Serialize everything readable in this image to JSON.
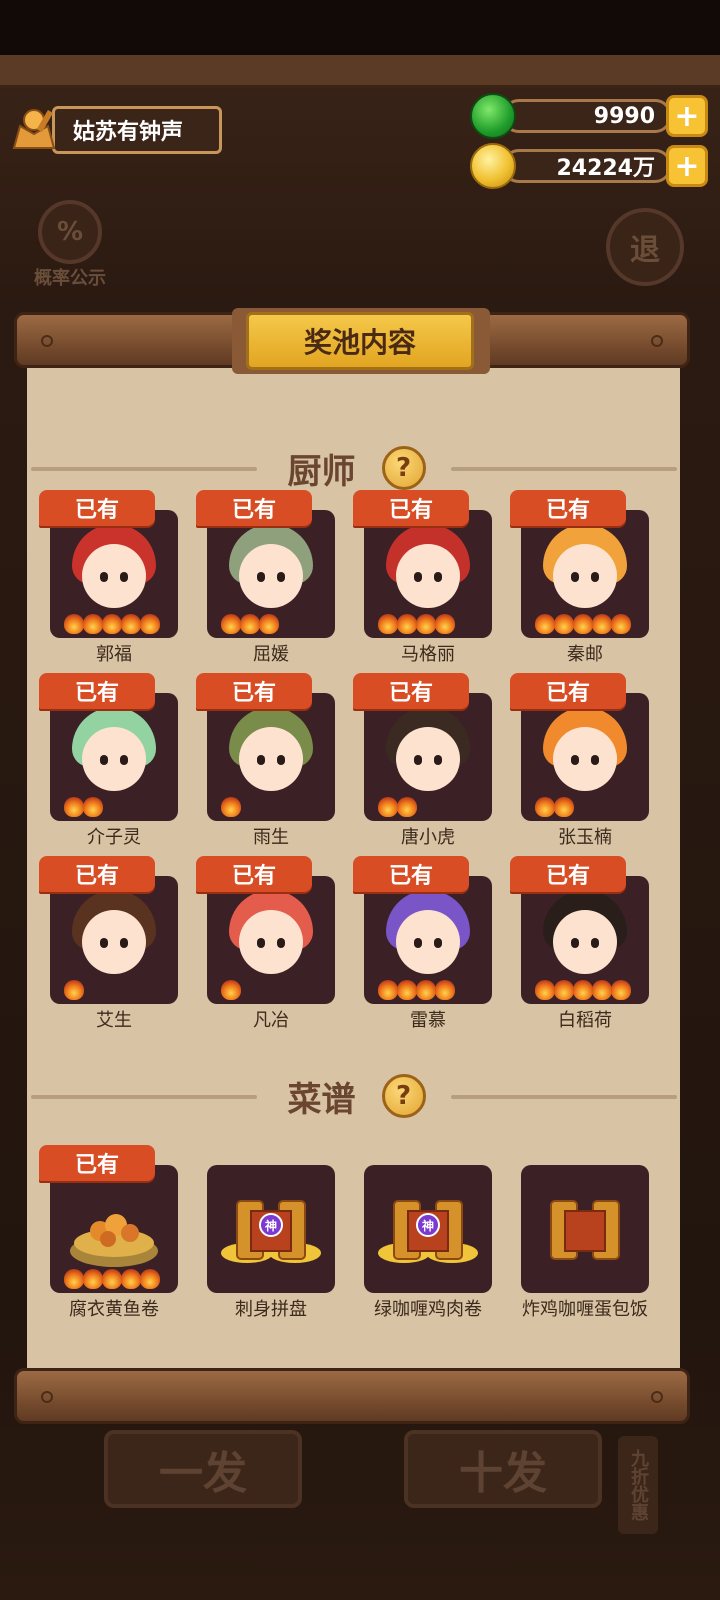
{
  "player": {
    "name": "姑苏有钟声"
  },
  "currency": {
    "jade": "9990",
    "coins": "24224万",
    "plus": "+"
  },
  "side": {
    "probability_icon": "%",
    "probability_label": "概率公示",
    "exit_label": "退"
  },
  "panel": {
    "title": "奖池内容"
  },
  "sections": {
    "chefs": "厨师",
    "recipes": "菜谱",
    "help": "?"
  },
  "owned_label": "已有",
  "chefs": [
    {
      "name": "郭福",
      "owned": true,
      "stars": 5,
      "hair": "#c9332b"
    },
    {
      "name": "屈媛",
      "owned": true,
      "stars": 3,
      "hair": "#8fa07d"
    },
    {
      "name": "马格丽",
      "owned": true,
      "stars": 4,
      "hair": "#c4302a"
    },
    {
      "name": "秦邮",
      "owned": true,
      "stars": 5,
      "hair": "#f2a23a"
    },
    {
      "name": "介子灵",
      "owned": true,
      "stars": 2,
      "hair": "#93d3a2"
    },
    {
      "name": "雨生",
      "owned": true,
      "stars": 1,
      "hair": "#7a8c4a"
    },
    {
      "name": "唐小虎",
      "owned": true,
      "stars": 2,
      "hair": "#3a2a22"
    },
    {
      "name": "张玉楠",
      "owned": true,
      "stars": 2,
      "hair": "#f08a2c"
    },
    {
      "name": "艾生",
      "owned": true,
      "stars": 1,
      "hair": "#5a3320"
    },
    {
      "name": "凡冶",
      "owned": true,
      "stars": 1,
      "hair": "#e45d4c"
    },
    {
      "name": "雷慕",
      "owned": true,
      "stars": 4,
      "hair": "#7a55c8"
    },
    {
      "name": "白稻荷",
      "owned": true,
      "stars": 5,
      "hair": "#2a1e1a"
    }
  ],
  "recipes": [
    {
      "name": "腐衣黄鱼卷",
      "owned": true,
      "stars": 5,
      "kind": "dish"
    },
    {
      "name": "刺身拼盘",
      "owned": false,
      "stars": 0,
      "kind": "divine-scroll",
      "badge": "神"
    },
    {
      "name": "绿咖喱鸡肉卷",
      "owned": false,
      "stars": 0,
      "kind": "divine-scroll",
      "badge": "神"
    },
    {
      "name": "炸鸡咖喱蛋包饭",
      "owned": false,
      "stars": 0,
      "kind": "scroll"
    }
  ],
  "bottom": {
    "single": "一发",
    "ten": "十发",
    "discount": "九折优惠"
  }
}
